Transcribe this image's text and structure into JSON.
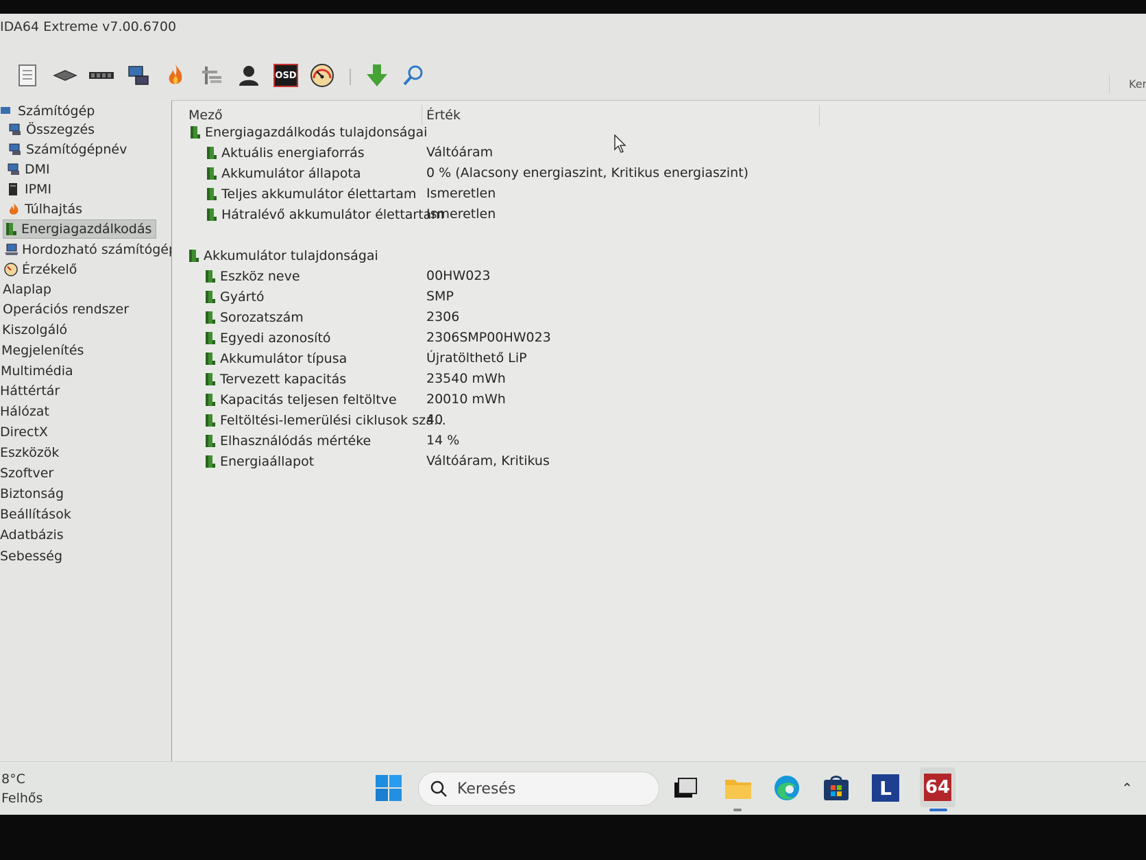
{
  "window": {
    "title": "IDA64 Extreme v7.00.6700"
  },
  "toolbar": {
    "buttons": [
      "report-icon",
      "motherboard-icon",
      "memory-icon",
      "network-icon",
      "flame-icon",
      "tools-icon",
      "user-icon",
      "osd-icon",
      "gauge-icon",
      "download-icon",
      "search-icon"
    ],
    "osd_label": "OSD",
    "right_text": "Ker"
  },
  "nav": {
    "items": [
      {
        "label": "Számítógép",
        "icon": "computer-icon"
      },
      {
        "label": "Összegzés",
        "icon": "computer-icon"
      },
      {
        "label": "Számítógépnév",
        "icon": "computer-icon"
      },
      {
        "label": "DMI",
        "icon": "computer-icon"
      },
      {
        "label": "IPMI",
        "icon": "server-icon"
      },
      {
        "label": "Túlhajtás",
        "icon": "flame-icon"
      },
      {
        "label": "Energiagazdálkodás",
        "icon": "battery-icon",
        "selected": true
      },
      {
        "label": "Hordozható számítógép",
        "icon": "laptop-icon"
      },
      {
        "label": "Érzékelő",
        "icon": "gauge-icon"
      },
      {
        "label": "Alaplap"
      },
      {
        "label": "Operációs rendszer"
      },
      {
        "label": "Kiszolgáló"
      },
      {
        "label": "Megjelenítés"
      },
      {
        "label": "Multimédia"
      },
      {
        "label": "Háttértár"
      },
      {
        "label": "Hálózat"
      },
      {
        "label": "DirectX"
      },
      {
        "label": "Eszközök"
      },
      {
        "label": "Szoftver"
      },
      {
        "label": "Biztonság"
      },
      {
        "label": "Beállítások"
      },
      {
        "label": "Adatbázis"
      },
      {
        "label": "Sebesség"
      }
    ]
  },
  "main": {
    "columns": {
      "field": "Mező",
      "value": "Érték"
    },
    "sections": [
      {
        "title": "Energiagazdálkodás tulajdonságai",
        "rows": [
          {
            "field": "Aktuális energiaforrás",
            "value": "Váltóáram"
          },
          {
            "field": "Akkumulátor állapota",
            "value": "0 % (Alacsony energiaszint, Kritikus energiaszint)"
          },
          {
            "field": "Teljes akkumulátor élettartam",
            "value": "Ismeretlen"
          },
          {
            "field": "Hátralévő akkumulátor élettartam",
            "value": "Ismeretlen"
          }
        ]
      },
      {
        "title": "Akkumulátor tulajdonságai",
        "rows": [
          {
            "field": "Eszköz neve",
            "value": "00HW023"
          },
          {
            "field": "Gyártó",
            "value": "SMP"
          },
          {
            "field": "Sorozatszám",
            "value": "2306"
          },
          {
            "field": "Egyedi azonosító",
            "value": "2306SMP00HW023"
          },
          {
            "field": "Akkumulátor típusa",
            "value": "Újratölthető LiP"
          },
          {
            "field": "Tervezett kapacitás",
            "value": "23540 mWh"
          },
          {
            "field": "Kapacitás teljesen feltöltve",
            "value": "20010 mWh"
          },
          {
            "field": "Feltöltési-lemerülési ciklusok szá...",
            "value": "40"
          },
          {
            "field": "Elhasználódás mértéke",
            "value": "14 %"
          },
          {
            "field": "Energiaállapot",
            "value": "Váltóáram, Kritikus"
          }
        ]
      }
    ]
  },
  "taskbar": {
    "weather": {
      "temp": "8°C",
      "desc": "Felhős"
    },
    "search_placeholder": "Keresés",
    "apps": [
      "windows-start-icon",
      "task-view-icon",
      "file-explorer-icon",
      "edge-icon",
      "store-icon",
      "l-app-icon",
      "aida64-icon"
    ],
    "l_label": "L",
    "aida_label": "64"
  }
}
